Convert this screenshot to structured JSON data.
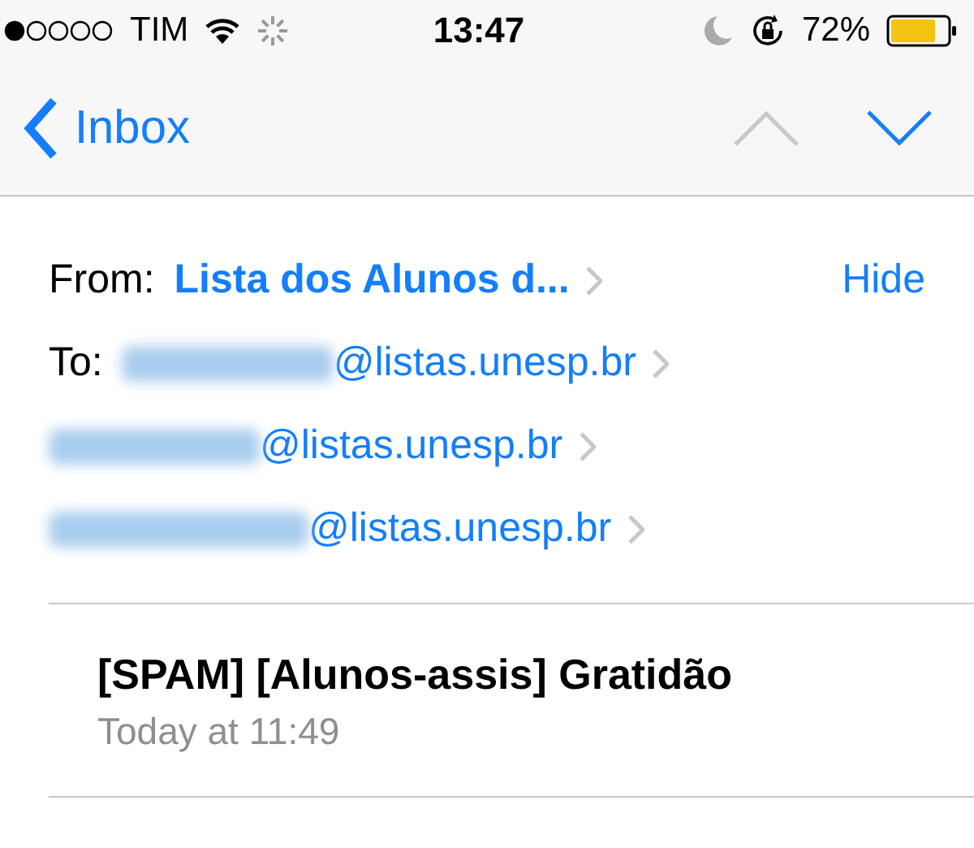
{
  "status_bar": {
    "carrier": "TIM",
    "time": "13:47",
    "battery": "72%"
  },
  "nav": {
    "back_label": "Inbox",
    "previous_enabled": false,
    "next_enabled": true
  },
  "header": {
    "from_label": "From:",
    "from_name": "Lista dos Alunos d...",
    "hide_label": "Hide",
    "to_label": "To:",
    "recipients": [
      {
        "address": "@listas.unesp.br"
      },
      {
        "address": "@listas.unesp.br"
      },
      {
        "address": "@listas.unesp.br"
      }
    ]
  },
  "message": {
    "subject": "[SPAM] [Alunos-assis] Gratidão",
    "date": "Today at 11:49"
  }
}
